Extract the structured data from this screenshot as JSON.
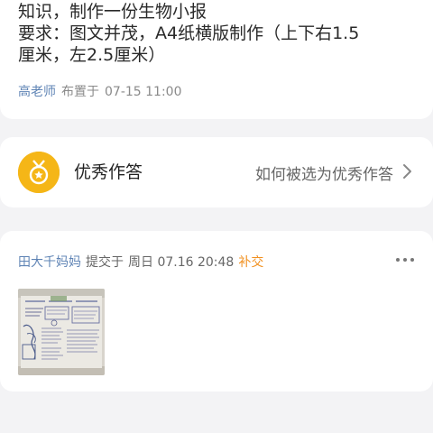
{
  "assignment": {
    "lines": [
      "知识，制作一份生物小报",
      "要求：图文并茂，A4纸横版制作（上下右1.5",
      "厘米，左2.5厘米）"
    ],
    "teacher": "高老师",
    "published_label": "布置于",
    "published_time": "07-15 11:00"
  },
  "excellent": {
    "icon": "medal-icon",
    "title": "优秀作答",
    "link_label": "如何被选为优秀作答"
  },
  "submission": {
    "parent_name": "田大千妈妈",
    "submitted_label": "提交于",
    "submitted_time": "周日 07.16 20:48",
    "late_badge": "补交",
    "attachment": "newspaper-photo"
  },
  "colors": {
    "page_background": "#f3f3f5",
    "card_background": "#ffffff",
    "name_blue": "#5f84b5",
    "medal_gold": "#f5b617",
    "late_orange": "#f1901f"
  }
}
